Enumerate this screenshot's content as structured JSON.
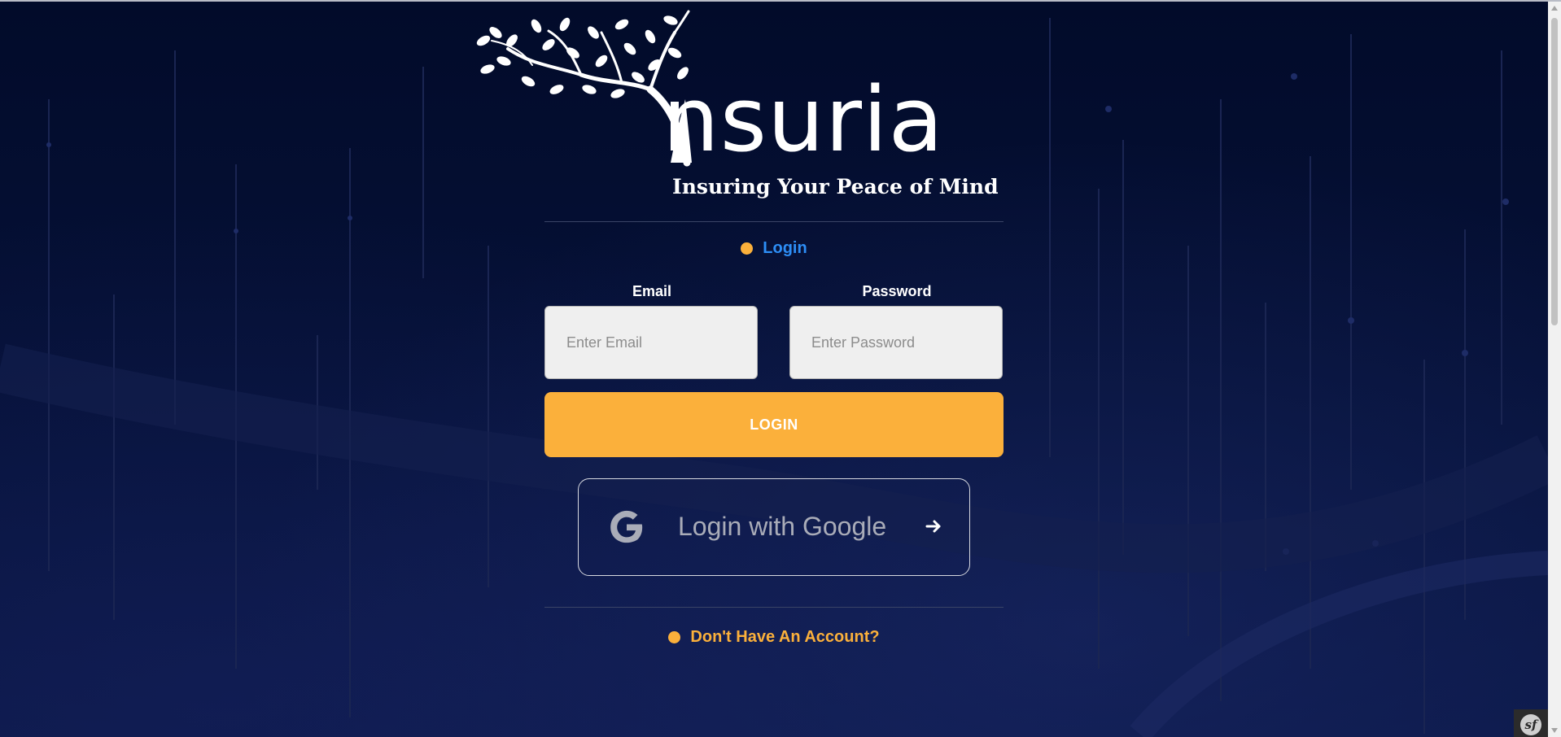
{
  "brand": {
    "name": "nsuria",
    "tagline": "Insuring Your Peace of Mind"
  },
  "login_section": {
    "heading": "Login",
    "email": {
      "label": "Email",
      "placeholder": "Enter Email",
      "value": ""
    },
    "password": {
      "label": "Password",
      "placeholder": "Enter Password",
      "value": ""
    },
    "submit_label": "LOGIN",
    "google_label": "Login with Google"
  },
  "signup": {
    "link_label": "Don't Have An Account?"
  },
  "colors": {
    "background": "#020b2a",
    "accent_orange": "#fbb03b",
    "link_blue": "#2d8ef6"
  },
  "icons": {
    "google": "google-g-icon",
    "arrow": "arrow-right-icon",
    "debug_toolbar": "symfony-icon"
  }
}
